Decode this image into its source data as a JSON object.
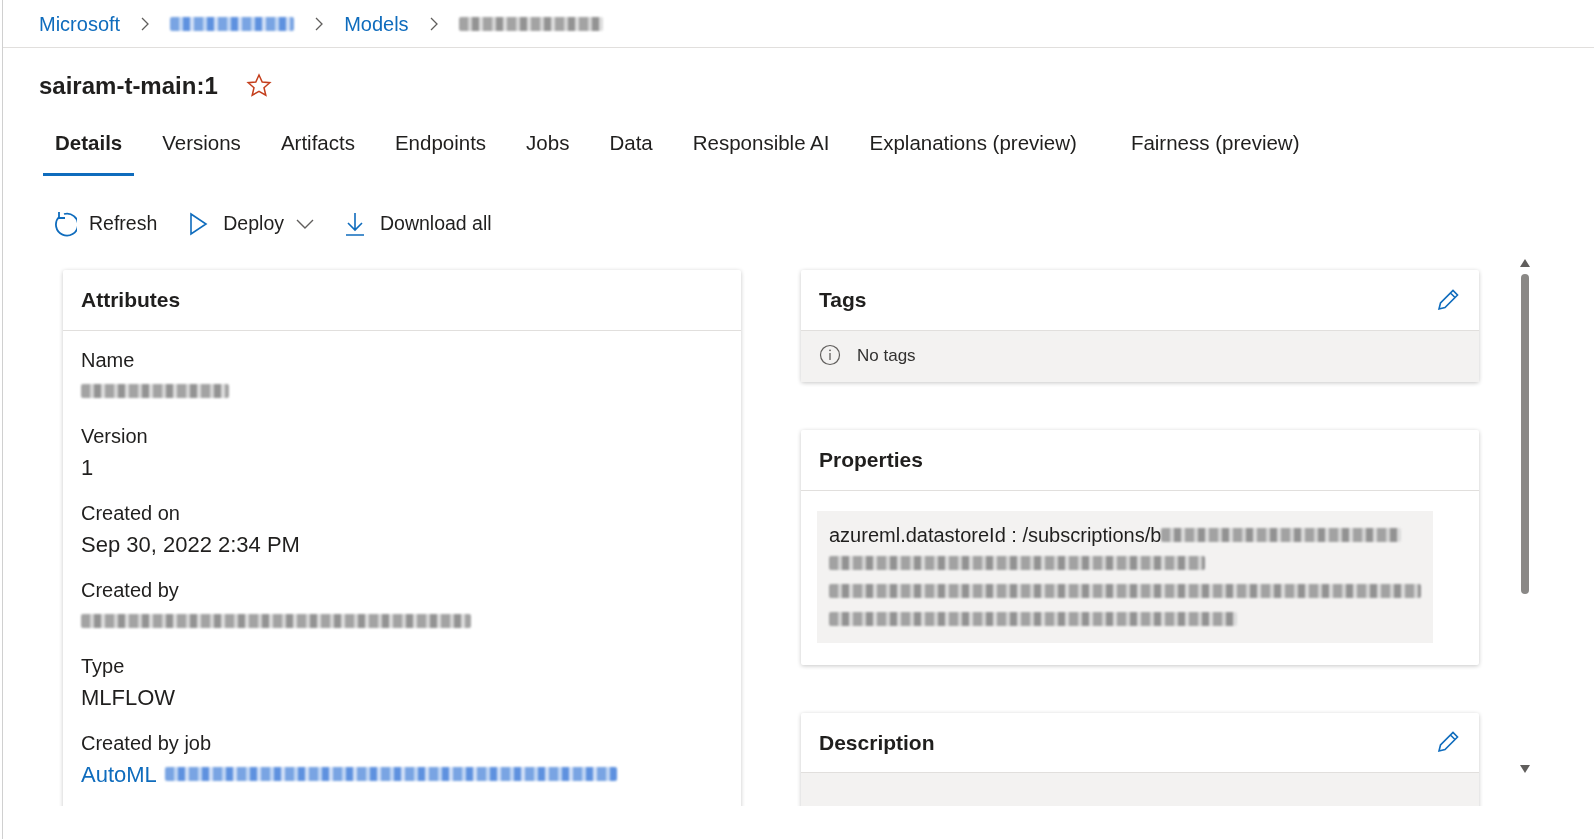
{
  "breadcrumb": [
    {
      "kind": "link",
      "label": "Microsoft"
    },
    {
      "kind": "redacted",
      "link": true
    },
    {
      "kind": "link",
      "label": "Models"
    },
    {
      "kind": "redacted",
      "link": false
    }
  ],
  "title": "sairam-t-main:1",
  "favorite": false,
  "tabs": [
    {
      "label": "Details",
      "selected": true
    },
    {
      "label": "Versions",
      "selected": false
    },
    {
      "label": "Artifacts",
      "selected": false
    },
    {
      "label": "Endpoints",
      "selected": false
    },
    {
      "label": "Jobs",
      "selected": false
    },
    {
      "label": "Data",
      "selected": false
    },
    {
      "label": "Responsible AI",
      "selected": false
    },
    {
      "label": "Explanations (preview)",
      "selected": false
    },
    {
      "label": "Fairness (preview)",
      "selected": false
    }
  ],
  "toolbar": [
    {
      "kind": "refresh",
      "label": "Refresh"
    },
    {
      "kind": "deploy",
      "label": "Deploy",
      "dropdown": true
    },
    {
      "kind": "download",
      "label": "Download all"
    }
  ],
  "attributes": {
    "title": "Attributes",
    "fields": [
      {
        "label": "Name",
        "kind": "redacted"
      },
      {
        "label": "Version",
        "kind": "text",
        "value": "1"
      },
      {
        "label": "Created on",
        "kind": "text",
        "value": "Sep 30, 2022 2:34 PM"
      },
      {
        "label": "Created by",
        "kind": "redacted"
      },
      {
        "label": "Type",
        "kind": "text",
        "value": "MLFLOW"
      },
      {
        "label": "Created by job",
        "kind": "link",
        "value": "AutoML"
      }
    ]
  },
  "tags": {
    "title": "Tags",
    "editable": true,
    "empty_text": "No tags"
  },
  "properties": {
    "title": "Properties",
    "text": "azureml.datastoreId : /subscriptions/b"
  },
  "description": {
    "title": "Description",
    "editable": true
  }
}
